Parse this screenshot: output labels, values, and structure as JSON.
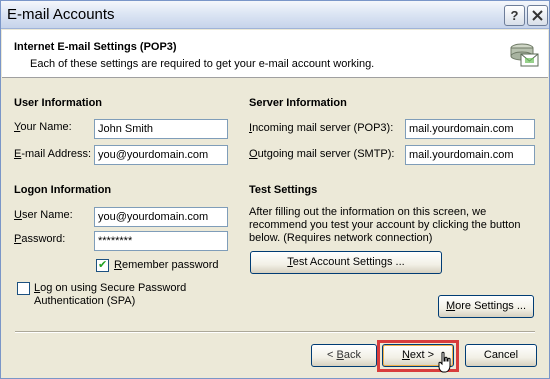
{
  "window": {
    "title": "E-mail Accounts",
    "help_button": "?",
    "close_button": "✕"
  },
  "header": {
    "title": "Internet E-mail Settings (POP3)",
    "description": "Each of these settings are required to get your e-mail account working."
  },
  "user_info": {
    "heading": "User Information",
    "name_label_underlined": "Y",
    "name_label_rest": "our Name:",
    "name_value": "John Smith",
    "email_label_underlined": "E",
    "email_label_rest": "-mail Address:",
    "email_value": "you@yourdomain.com"
  },
  "server_info": {
    "heading": "Server Information",
    "incoming_label_underlined": "I",
    "incoming_label_rest": "ncoming mail server (POP3):",
    "incoming_value": "mail.yourdomain.com",
    "outgoing_label_underlined": "O",
    "outgoing_label_rest": "utgoing mail server (SMTP):",
    "outgoing_value": "mail.yourdomain.com"
  },
  "logon_info": {
    "heading": "Logon Information",
    "username_label_underlined": "U",
    "username_label_rest": "ser Name:",
    "username_value": "you@yourdomain.com",
    "password_label_underlined": "P",
    "password_label_rest": "assword:",
    "password_value": "********",
    "remember_label_underlined": "R",
    "remember_label_rest": "emember password",
    "remember_checked": true,
    "spa_label_line1_underlined": "L",
    "spa_label_line1_rest": "og on using Secure Password",
    "spa_label_line2": "Authentication (SPA)",
    "spa_checked": false
  },
  "test_settings": {
    "heading": "Test Settings",
    "line1": "After filling out the information on this screen, we",
    "line2": "recommend you test your account by clicking the button",
    "line3": "below. (Requires network connection)",
    "button_underlined": "T",
    "button_rest": "est Account Settings ..."
  },
  "more_settings": {
    "underlined": "M",
    "rest": "ore Settings ..."
  },
  "footer": {
    "back_prefix": "< ",
    "back_underlined": "B",
    "back_rest": "ack",
    "next_underlined": "N",
    "next_rest": "ext >",
    "cancel": "Cancel"
  },
  "colors": {
    "highlight": "#d83c3c",
    "field_border": "#7f9db9",
    "dialog_bg": "#ece9d8"
  }
}
